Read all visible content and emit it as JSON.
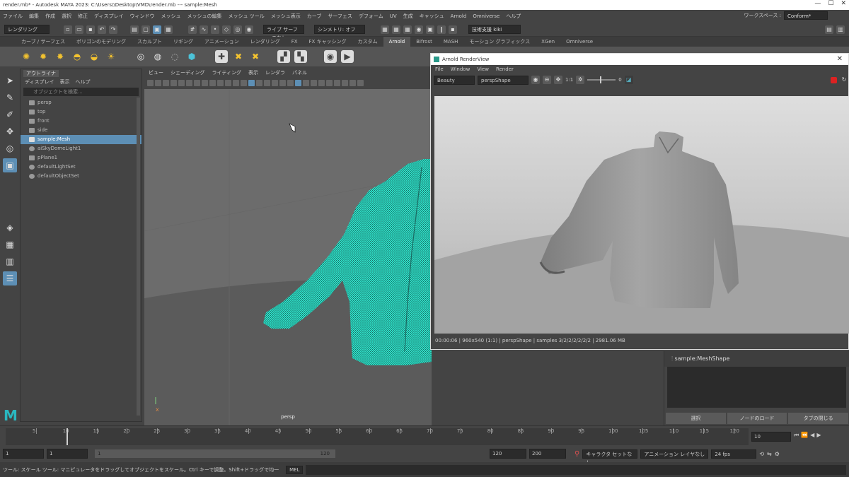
{
  "window": {
    "title": "render.mb* - Autodesk MAYA 2023: C:\\Users\\\\Desktop\\VMD\\render.mb --- sample:Mesh",
    "controls": [
      "—",
      "☐",
      "✕"
    ]
  },
  "menubar": {
    "items": [
      "ファイル",
      "編集",
      "作成",
      "選択",
      "修正",
      "ディスプレイ",
      "ウィンドウ",
      "メッシュ",
      "メッシュの編集",
      "メッシュ ツール",
      "メッシュ表示",
      "カーブ",
      "サーフェス",
      "デフォーム",
      "UV",
      "生成",
      "キャッシュ",
      "Arnold",
      "Omniverse",
      "ヘルプ"
    ],
    "workspace_label": "ワークスペース :",
    "workspace_value": "Conform*"
  },
  "statusline": {
    "mode": "レンダリング",
    "symmetry": "シンメトリ: オフ",
    "no_live": "ライブ サーフェスなし",
    "user": "技術支援 kiki"
  },
  "shelf": {
    "tabs": [
      "カーブ / サーフェス",
      "ポリゴンのモデリング",
      "スカルプト",
      "リギング",
      "アニメーション",
      "レンダリング",
      "FX",
      "FX キャッシング",
      "カスタム",
      "Arnold",
      "Bifrost",
      "MASH",
      "モーション グラフィックス",
      "XGen",
      "Omniverse"
    ],
    "active_tab": "Arnold"
  },
  "outliner": {
    "tab": "アウトライナ",
    "menu": [
      "ディスプレイ",
      "表示",
      "ヘルプ"
    ],
    "search_placeholder": "オブジェクトを検索...",
    "items": [
      {
        "label": "persp",
        "type": "camera",
        "selected": false
      },
      {
        "label": "top",
        "type": "camera",
        "selected": false
      },
      {
        "label": "front",
        "type": "camera",
        "selected": false
      },
      {
        "label": "side",
        "type": "camera",
        "selected": false
      },
      {
        "label": "sample:Mesh",
        "type": "mesh",
        "selected": true
      },
      {
        "label": "aiSkyDomeLight1",
        "type": "light",
        "selected": false
      },
      {
        "label": "pPlane1",
        "type": "mesh",
        "selected": false
      },
      {
        "label": "defaultLightSet",
        "type": "set",
        "selected": false
      },
      {
        "label": "defaultObjectSet",
        "type": "set",
        "selected": false
      }
    ]
  },
  "viewport": {
    "menu": [
      "ビュー",
      "シェーディング",
      "ライティング",
      "表示",
      "レンダラ",
      "パネル"
    ],
    "camera_label": "persp"
  },
  "render_view": {
    "title": "Arnold RenderView",
    "menu": [
      "File",
      "Window",
      "View",
      "Render"
    ],
    "aov": "Beauty",
    "camera": "perspShape",
    "ratio": "1:1",
    "exposure": "0",
    "status_text": "00:00:06 | 960x540 (1:1) | perspShape | samples 3/2/2/2/2/2/2 | 2981.06 MB"
  },
  "attribute_panel": {
    "node": "sample:MeshShape",
    "buttons": [
      "選択",
      "ノードのロード",
      "タブの閉じる"
    ]
  },
  "timeline": {
    "ticks": [
      "5",
      "10",
      "15",
      "20",
      "25",
      "30",
      "35",
      "40",
      "45",
      "50",
      "55",
      "60",
      "65",
      "70",
      "75",
      "80",
      "85",
      "90",
      "95",
      "100",
      "105",
      "110",
      "115",
      "120"
    ],
    "current_frame": "10"
  },
  "range": {
    "start": "1",
    "playback_start": "1",
    "slider_start": "1",
    "slider_end": "120",
    "playback_end": "120",
    "end": "200",
    "char_set": "キャラクタ セットなし",
    "anim_layer": "アニメーション レイヤなし",
    "fps": "24 fps"
  },
  "commandline": {
    "help": "ツール: スケール ツール: マニピュレータをドラッグしてオブジェクトをスケール。Ctrl キーで調整。Shift+ドラッグで均一",
    "mel": "MEL"
  }
}
